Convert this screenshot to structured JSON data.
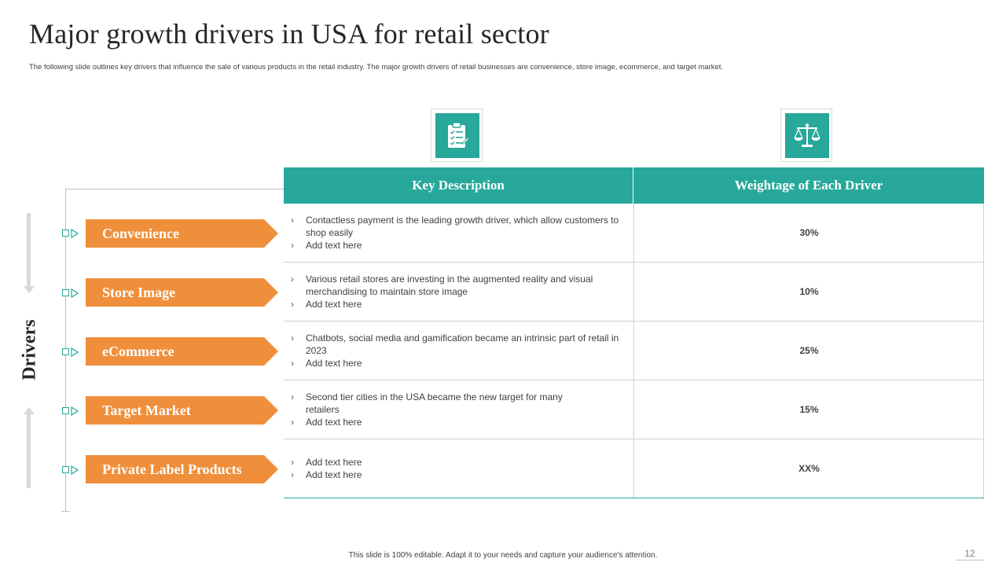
{
  "header": {
    "title": "Major growth drivers in USA for retail sector",
    "subtitle": "The following slide outlines key drivers that influence the sale of various products in the retail industry. The major growth drivers of retail businesses are convenience, store image, ecommerce, and target market."
  },
  "icons": {
    "description_icon": "clipboard-checklist-icon",
    "weightage_icon": "balance-scale-icon"
  },
  "side_label": "Drivers",
  "table": {
    "headers": {
      "description": "Key Description",
      "weightage": "Weightage of Each Driver"
    },
    "rows": [
      {
        "driver": "Convenience",
        "bullets": [
          "Contactless payment is the leading growth driver, which allow customers to shop easily",
          "Add text here"
        ],
        "weight": "30%"
      },
      {
        "driver": "Store Image",
        "bullets": [
          "Various retail stores are investing in the augmented reality and visual merchandising to maintain store image",
          "Add text here"
        ],
        "weight": "10%"
      },
      {
        "driver": "eCommerce",
        "bullets": [
          "Chatbots, social media and gamification became an intrinsic part of retail in 2023",
          "Add text here"
        ],
        "weight": "25%"
      },
      {
        "driver": "Target Market",
        "bullets": [
          "Second tier cities in the USA became the new target for many retailers",
          "Add text here"
        ],
        "weight": "15%"
      },
      {
        "driver": "Private Label Products",
        "bullets": [
          "Add text here",
          "Add text here"
        ],
        "weight": "XX%"
      }
    ]
  },
  "footer": {
    "note": "This slide is 100% editable. Adapt it to your needs and capture your audience's attention.",
    "page_number": "12"
  },
  "colors": {
    "accent_teal": "#27a89a",
    "accent_orange": "#ef8f3b",
    "text_dark": "#262626"
  }
}
